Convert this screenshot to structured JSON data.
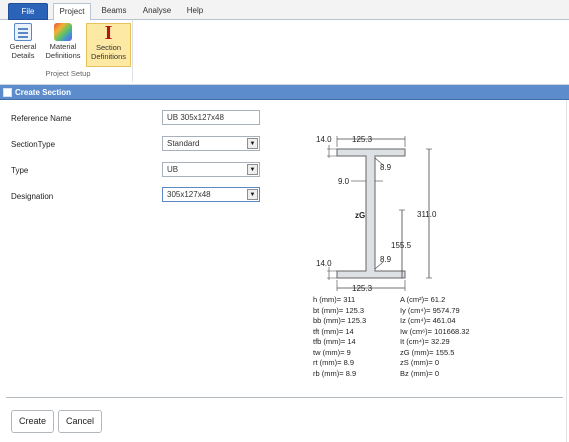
{
  "ribbon": {
    "tabs": [
      "File",
      "Project",
      "Beams",
      "Analyse",
      "Help"
    ],
    "buttons": {
      "general": [
        "General",
        "Details"
      ],
      "material": [
        "Material",
        "Definitions"
      ],
      "section": [
        "Section",
        "Definitions"
      ]
    },
    "group_label": "Project Setup"
  },
  "window": {
    "title": "Create Section"
  },
  "form": {
    "reference_name": {
      "label": "Reference Name",
      "value": "UB 305x127x48"
    },
    "section_type": {
      "label": "SectionType",
      "value": "Standard"
    },
    "type": {
      "label": "Type",
      "value": "UB"
    },
    "designation": {
      "label": "Designation",
      "value": "305x127x48"
    }
  },
  "drawing": {
    "top_flange_thickness": "14.0",
    "top_width": "125.3",
    "root_radius_top": "8.9",
    "web_thickness": "9.0",
    "centroid_label": "zG",
    "height": "311.0",
    "centroid_height": "155.5",
    "bottom_flange_thickness": "14.0",
    "root_radius_bottom": "8.9",
    "bottom_width": "125.3"
  },
  "properties": {
    "left": [
      {
        "label": "h (mm)=",
        "value": "311"
      },
      {
        "label": "bt (mm)=",
        "value": "125.3"
      },
      {
        "label": "bb (mm)=",
        "value": "125.3"
      },
      {
        "label": "tft (mm)=",
        "value": "14"
      },
      {
        "label": "tfb (mm)=",
        "value": "14"
      },
      {
        "label": "tw (mm)=",
        "value": "9"
      },
      {
        "label": "rt (mm)=",
        "value": "8.9"
      },
      {
        "label": "rb (mm)=",
        "value": "8.9"
      }
    ],
    "right": [
      {
        "label": "A (cm²)=",
        "value": "61.2"
      },
      {
        "label": "Iy (cm⁴)=",
        "value": "9574.79"
      },
      {
        "label": "Iz (cm⁴)=",
        "value": "461.04"
      },
      {
        "label": "Iw (cm⁶)=",
        "value": "101668.32"
      },
      {
        "label": "It (cm⁴)=",
        "value": "32.29"
      },
      {
        "label": "zG (mm)=",
        "value": "155.5"
      },
      {
        "label": "zS (mm)=",
        "value": "0"
      },
      {
        "label": "Bz (mm)=",
        "value": "0"
      }
    ]
  },
  "footer": {
    "create": "Create",
    "cancel": "Cancel"
  },
  "colors": {
    "accent": "#5c8ccc",
    "file_tab": "#2b63b8",
    "selected_ribbon": "#fde9a3"
  }
}
